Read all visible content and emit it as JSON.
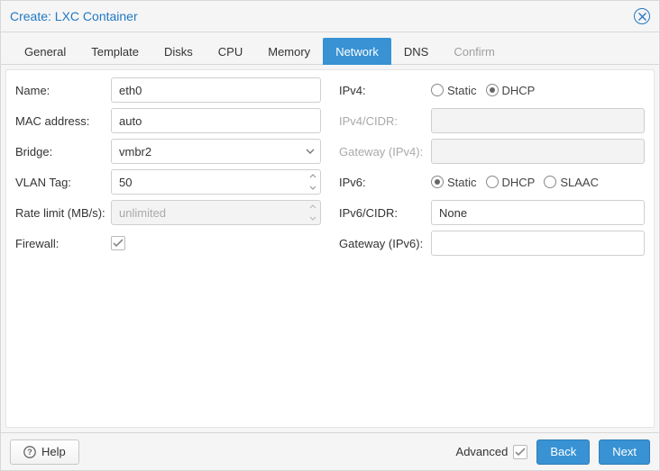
{
  "window": {
    "title": "Create: LXC Container"
  },
  "tabs": [
    {
      "id": "general",
      "label": "General",
      "active": false,
      "disabled": false
    },
    {
      "id": "template",
      "label": "Template",
      "active": false,
      "disabled": false
    },
    {
      "id": "disks",
      "label": "Disks",
      "active": false,
      "disabled": false
    },
    {
      "id": "cpu",
      "label": "CPU",
      "active": false,
      "disabled": false
    },
    {
      "id": "memory",
      "label": "Memory",
      "active": false,
      "disabled": false
    },
    {
      "id": "network",
      "label": "Network",
      "active": true,
      "disabled": false
    },
    {
      "id": "dns",
      "label": "DNS",
      "active": false,
      "disabled": false
    },
    {
      "id": "confirm",
      "label": "Confirm",
      "active": false,
      "disabled": true
    }
  ],
  "left": {
    "name": {
      "label": "Name:",
      "value": "eth0"
    },
    "mac": {
      "label": "MAC address:",
      "value": "auto"
    },
    "bridge": {
      "label": "Bridge:",
      "value": "vmbr2"
    },
    "vlan": {
      "label": "VLAN Tag:",
      "value": "50"
    },
    "rate": {
      "label": "Rate limit (MB/s):",
      "value": "unlimited",
      "disabled": true
    },
    "firewall": {
      "label": "Firewall:",
      "checked": true
    }
  },
  "right": {
    "ipv4": {
      "label": "IPv4:",
      "options": [
        {
          "id": "static",
          "label": "Static",
          "selected": false
        },
        {
          "id": "dhcp",
          "label": "DHCP",
          "selected": true
        }
      ]
    },
    "ipv4cidr": {
      "label": "IPv4/CIDR:",
      "value": "",
      "disabled": true
    },
    "gw4": {
      "label": "Gateway (IPv4):",
      "value": "",
      "disabled": true
    },
    "ipv6": {
      "label": "IPv6:",
      "options": [
        {
          "id": "static",
          "label": "Static",
          "selected": true
        },
        {
          "id": "dhcp",
          "label": "DHCP",
          "selected": false
        },
        {
          "id": "slaac",
          "label": "SLAAC",
          "selected": false
        }
      ]
    },
    "ipv6cidr": {
      "label": "IPv6/CIDR:",
      "value": "None"
    },
    "gw6": {
      "label": "Gateway (IPv6):",
      "value": ""
    }
  },
  "footer": {
    "help": "Help",
    "advanced_label": "Advanced",
    "advanced_checked": true,
    "back": "Back",
    "next": "Next"
  },
  "icons": {
    "close": "close-icon",
    "chevron_down": "chevron-down-icon",
    "help": "help-icon",
    "check": "check-icon"
  }
}
